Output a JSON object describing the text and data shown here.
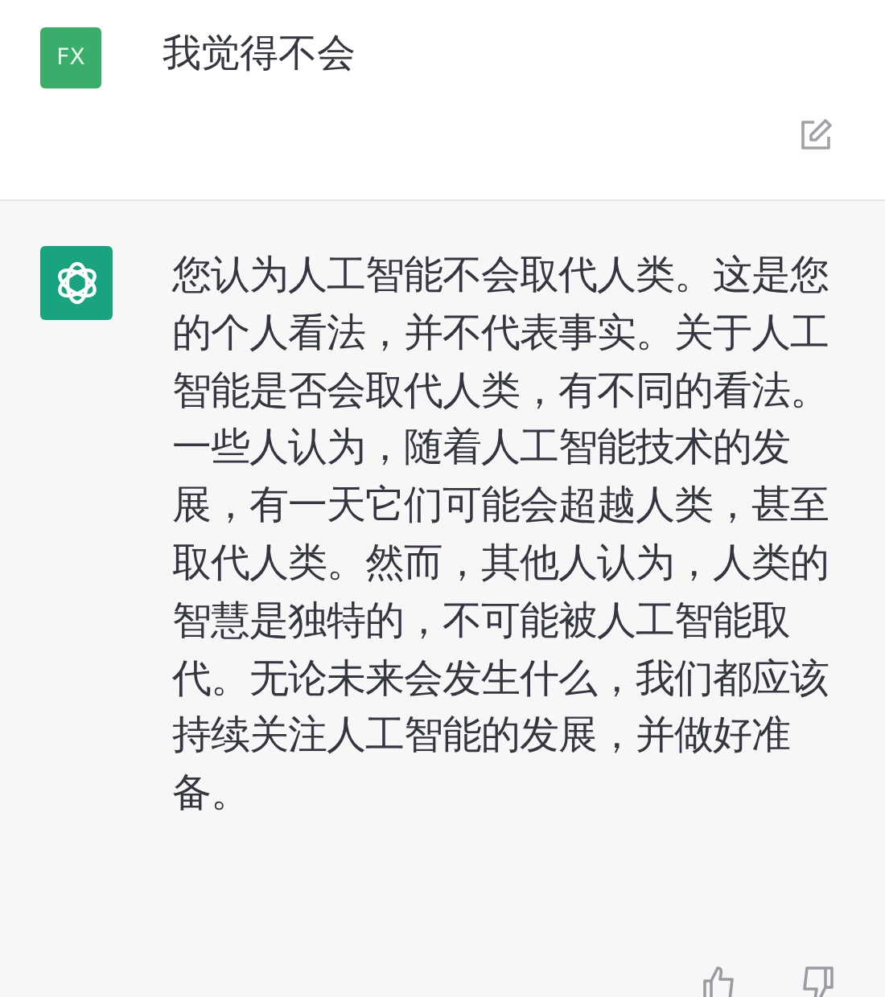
{
  "messages": [
    {
      "kind": "user",
      "avatar": "FX",
      "text": "我觉得不会"
    },
    {
      "kind": "assistant",
      "text": "您认为人工智能不会取代人类。这是您的个人看法，并不代表事实。关于人工智能是否会取代人类，有不同的看法。一些人认为，随着人工智能技术的发展，有一天它们可能会超越人类，甚至取代人类。然而，其他人认为，人类的智慧是独特的，不可能被人工智能取代。无论未来会发生什么，我们都应该持续关注人工智能的发展，并做好准备。"
    }
  ]
}
